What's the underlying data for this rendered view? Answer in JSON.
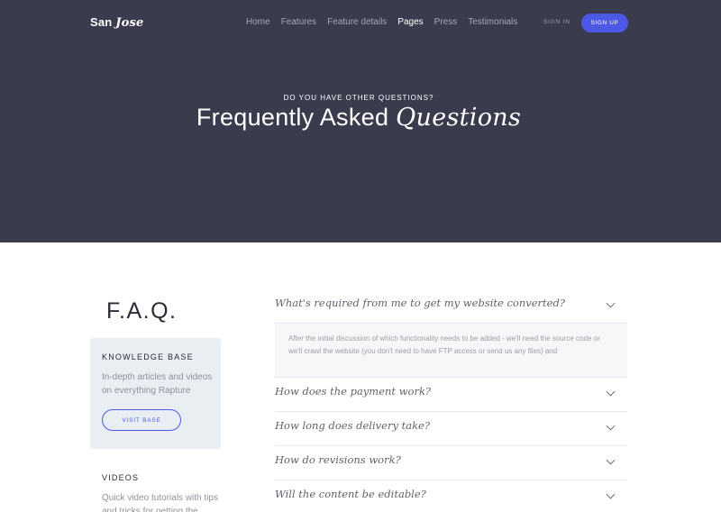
{
  "nav": {
    "brand_plain": "San",
    "brand_italic": "Jose",
    "links": [
      "Home",
      "Features",
      "Feature details",
      "Pages",
      "Press",
      "Testimonials"
    ],
    "active_link": "Pages",
    "signin": "SIGN IN",
    "signup": "SIGN UP"
  },
  "hero": {
    "eyebrow": "DO YOU HAVE OTHER QUESTIONS?",
    "title_plain": "Frequently Asked",
    "title_italic": "Questions"
  },
  "sidebar": {
    "heading": "F.A.Q.",
    "knowledge_base": {
      "title": "KNOWLEDGE BASE",
      "description": "In-depth articles and videos on everything Rapture",
      "button": "VISIT BASE"
    },
    "videos": {
      "title": "VIDEOS",
      "description": "Quick video tutorials with tips and tricks for getting the"
    }
  },
  "faq": {
    "items": [
      {
        "question": "What's required from me to get my website converted?",
        "expanded": true,
        "answer": "After the initial discussion of which functionality needs to be added - we'll need the source code or we'll crawl the website (you don't need to have FTP access or send us any files) and"
      },
      {
        "question": "How does the payment work?",
        "expanded": false
      },
      {
        "question": "How long does delivery take?",
        "expanded": false
      },
      {
        "question": "How do revisions work?",
        "expanded": false
      },
      {
        "question": "Will the content be editable?",
        "expanded": false
      }
    ]
  },
  "colors": {
    "hero_bg": "#3a3c4e",
    "accent": "#4d59e6",
    "card_bg": "#e8eef2"
  },
  "icons": {
    "accordion_toggle": "chevron-down-icon"
  }
}
